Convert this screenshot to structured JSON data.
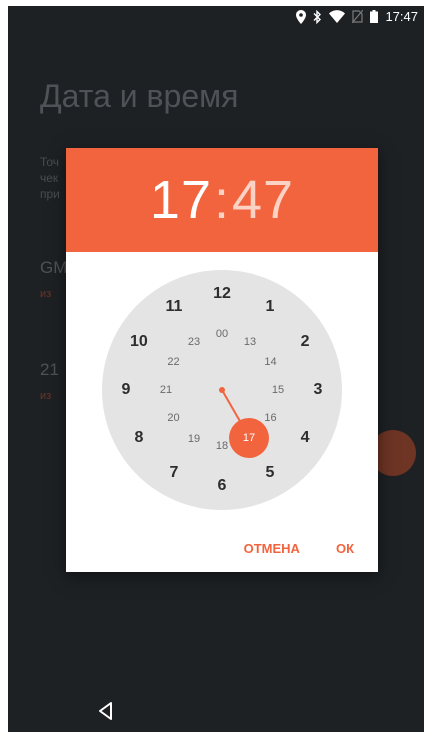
{
  "status_bar": {
    "time": "17:47",
    "icons": [
      "location-icon",
      "bluetooth-icon",
      "wifi-icon",
      "no-sim-icon",
      "battery-icon"
    ]
  },
  "background": {
    "title": "Дата и время",
    "description": "Точ\nчек\nпри",
    "row1_title": "GM",
    "row1_sub": "из",
    "row2_title": "21",
    "row2_sub": "из"
  },
  "dialog": {
    "header_hours": "17",
    "header_separator": ":",
    "header_minutes": "47",
    "outer_numbers": [
      "12",
      "1",
      "2",
      "3",
      "4",
      "5",
      "6",
      "7",
      "8",
      "9",
      "10",
      "11"
    ],
    "inner_numbers": [
      "00",
      "13",
      "14",
      "15",
      "16",
      "17",
      "18",
      "19",
      "20",
      "21",
      "22",
      "23"
    ],
    "selected_hour": "17",
    "cancel_label": "ОТМЕНА",
    "ok_label": "ОК"
  },
  "colors": {
    "accent": "#f2643e",
    "dial_background": "#e4e4e4",
    "screen_background": "#1e2124"
  },
  "nav": {
    "back_icon": "back-triangle-icon"
  }
}
